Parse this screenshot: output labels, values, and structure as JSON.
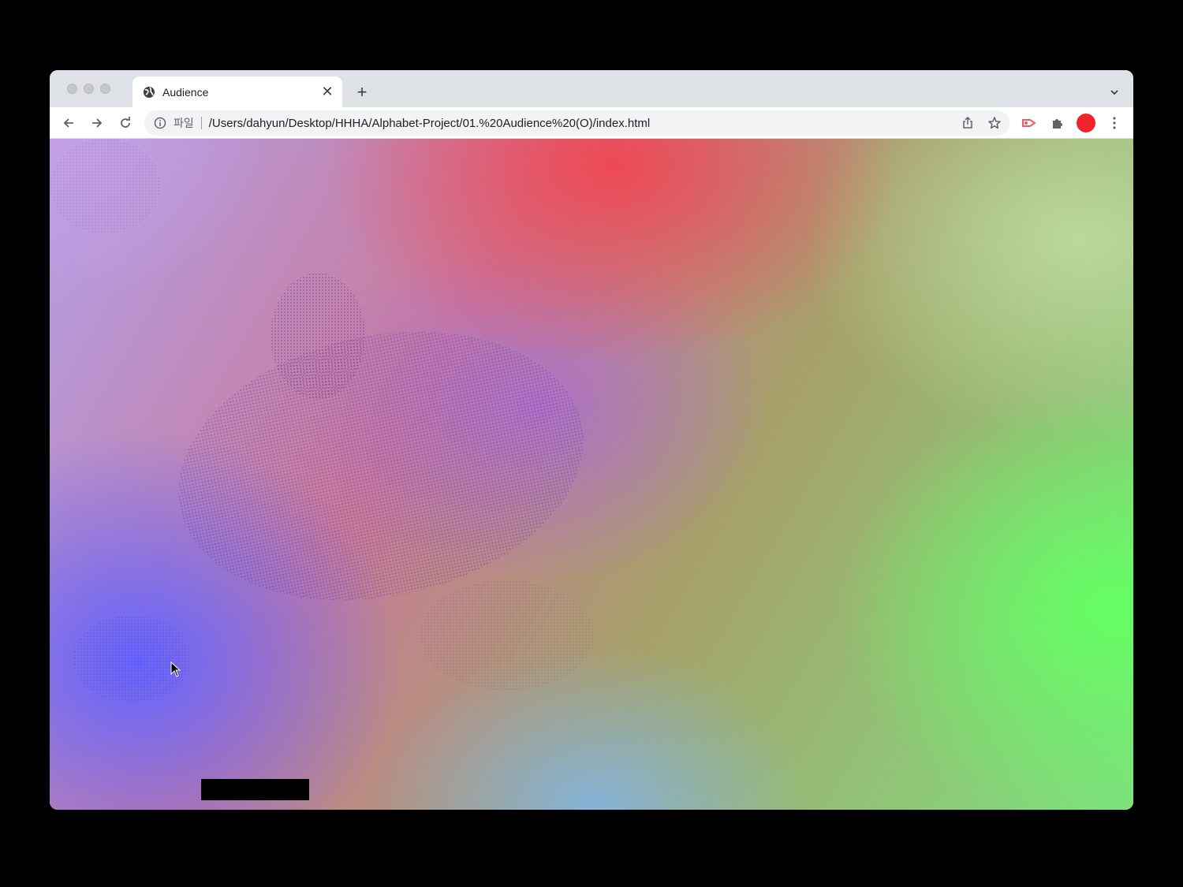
{
  "browser": {
    "tab": {
      "title": "Audience",
      "icon": "globe-icon"
    },
    "new_tab_label": "+",
    "close_label": "✕",
    "omnibox": {
      "scheme_label": "파일",
      "url": "/Users/dahyun/Desktop/HHHA/Alphabet-Project/01.%20Audience%20(O)/index.html"
    },
    "profile_color": "#f0242a"
  },
  "page": {
    "background": "gradient",
    "colors": {
      "red": "#f04650",
      "green": "#64ff64",
      "blue": "#6464ff",
      "purple": "#aa6ed2"
    }
  }
}
